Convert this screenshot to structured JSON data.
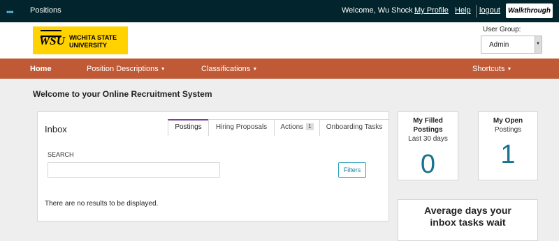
{
  "topbar": {
    "app_title": "Positions",
    "welcome": "Welcome, Wu Shock",
    "my_profile": "My Profile",
    "help": "Help",
    "logout": "logout",
    "walkthrough": "Walkthrough"
  },
  "header": {
    "logo_wsu": "WSU",
    "logo_line1": "WICHITA STATE",
    "logo_line2": "UNIVERSITY",
    "user_group_label": "User Group:",
    "user_group_value": "Admin"
  },
  "nav": {
    "home": "Home",
    "position_descriptions": "Position Descriptions",
    "classifications": "Classifications",
    "shortcuts": "Shortcuts"
  },
  "main": {
    "welcome_title": "Welcome to your Online Recruitment System",
    "inbox": {
      "title": "Inbox",
      "tabs": [
        {
          "label": "Postings"
        },
        {
          "label": "Hiring Proposals"
        },
        {
          "label": "Actions",
          "badge": "1"
        },
        {
          "label": "Onboarding Tasks"
        }
      ],
      "search_label": "SEARCH",
      "search_value": "",
      "filters_button": "Filters",
      "no_results": "There are no results to be displayed."
    },
    "filled_card": {
      "title_line1": "My Filled",
      "title_line2": "Postings",
      "subtitle": "Last 30 days",
      "count": "0"
    },
    "open_card": {
      "title": "My Open",
      "subtitle": "Postings",
      "count": "1"
    },
    "avg_card": {
      "line1": "Average days your",
      "line2": "inbox tasks wait"
    }
  },
  "colors": {
    "topbar": "#02242c",
    "navbar": "#c05a36",
    "logo": "#ffd200",
    "accent_teal": "#17738f",
    "active_tab": "#7a3e9d"
  }
}
